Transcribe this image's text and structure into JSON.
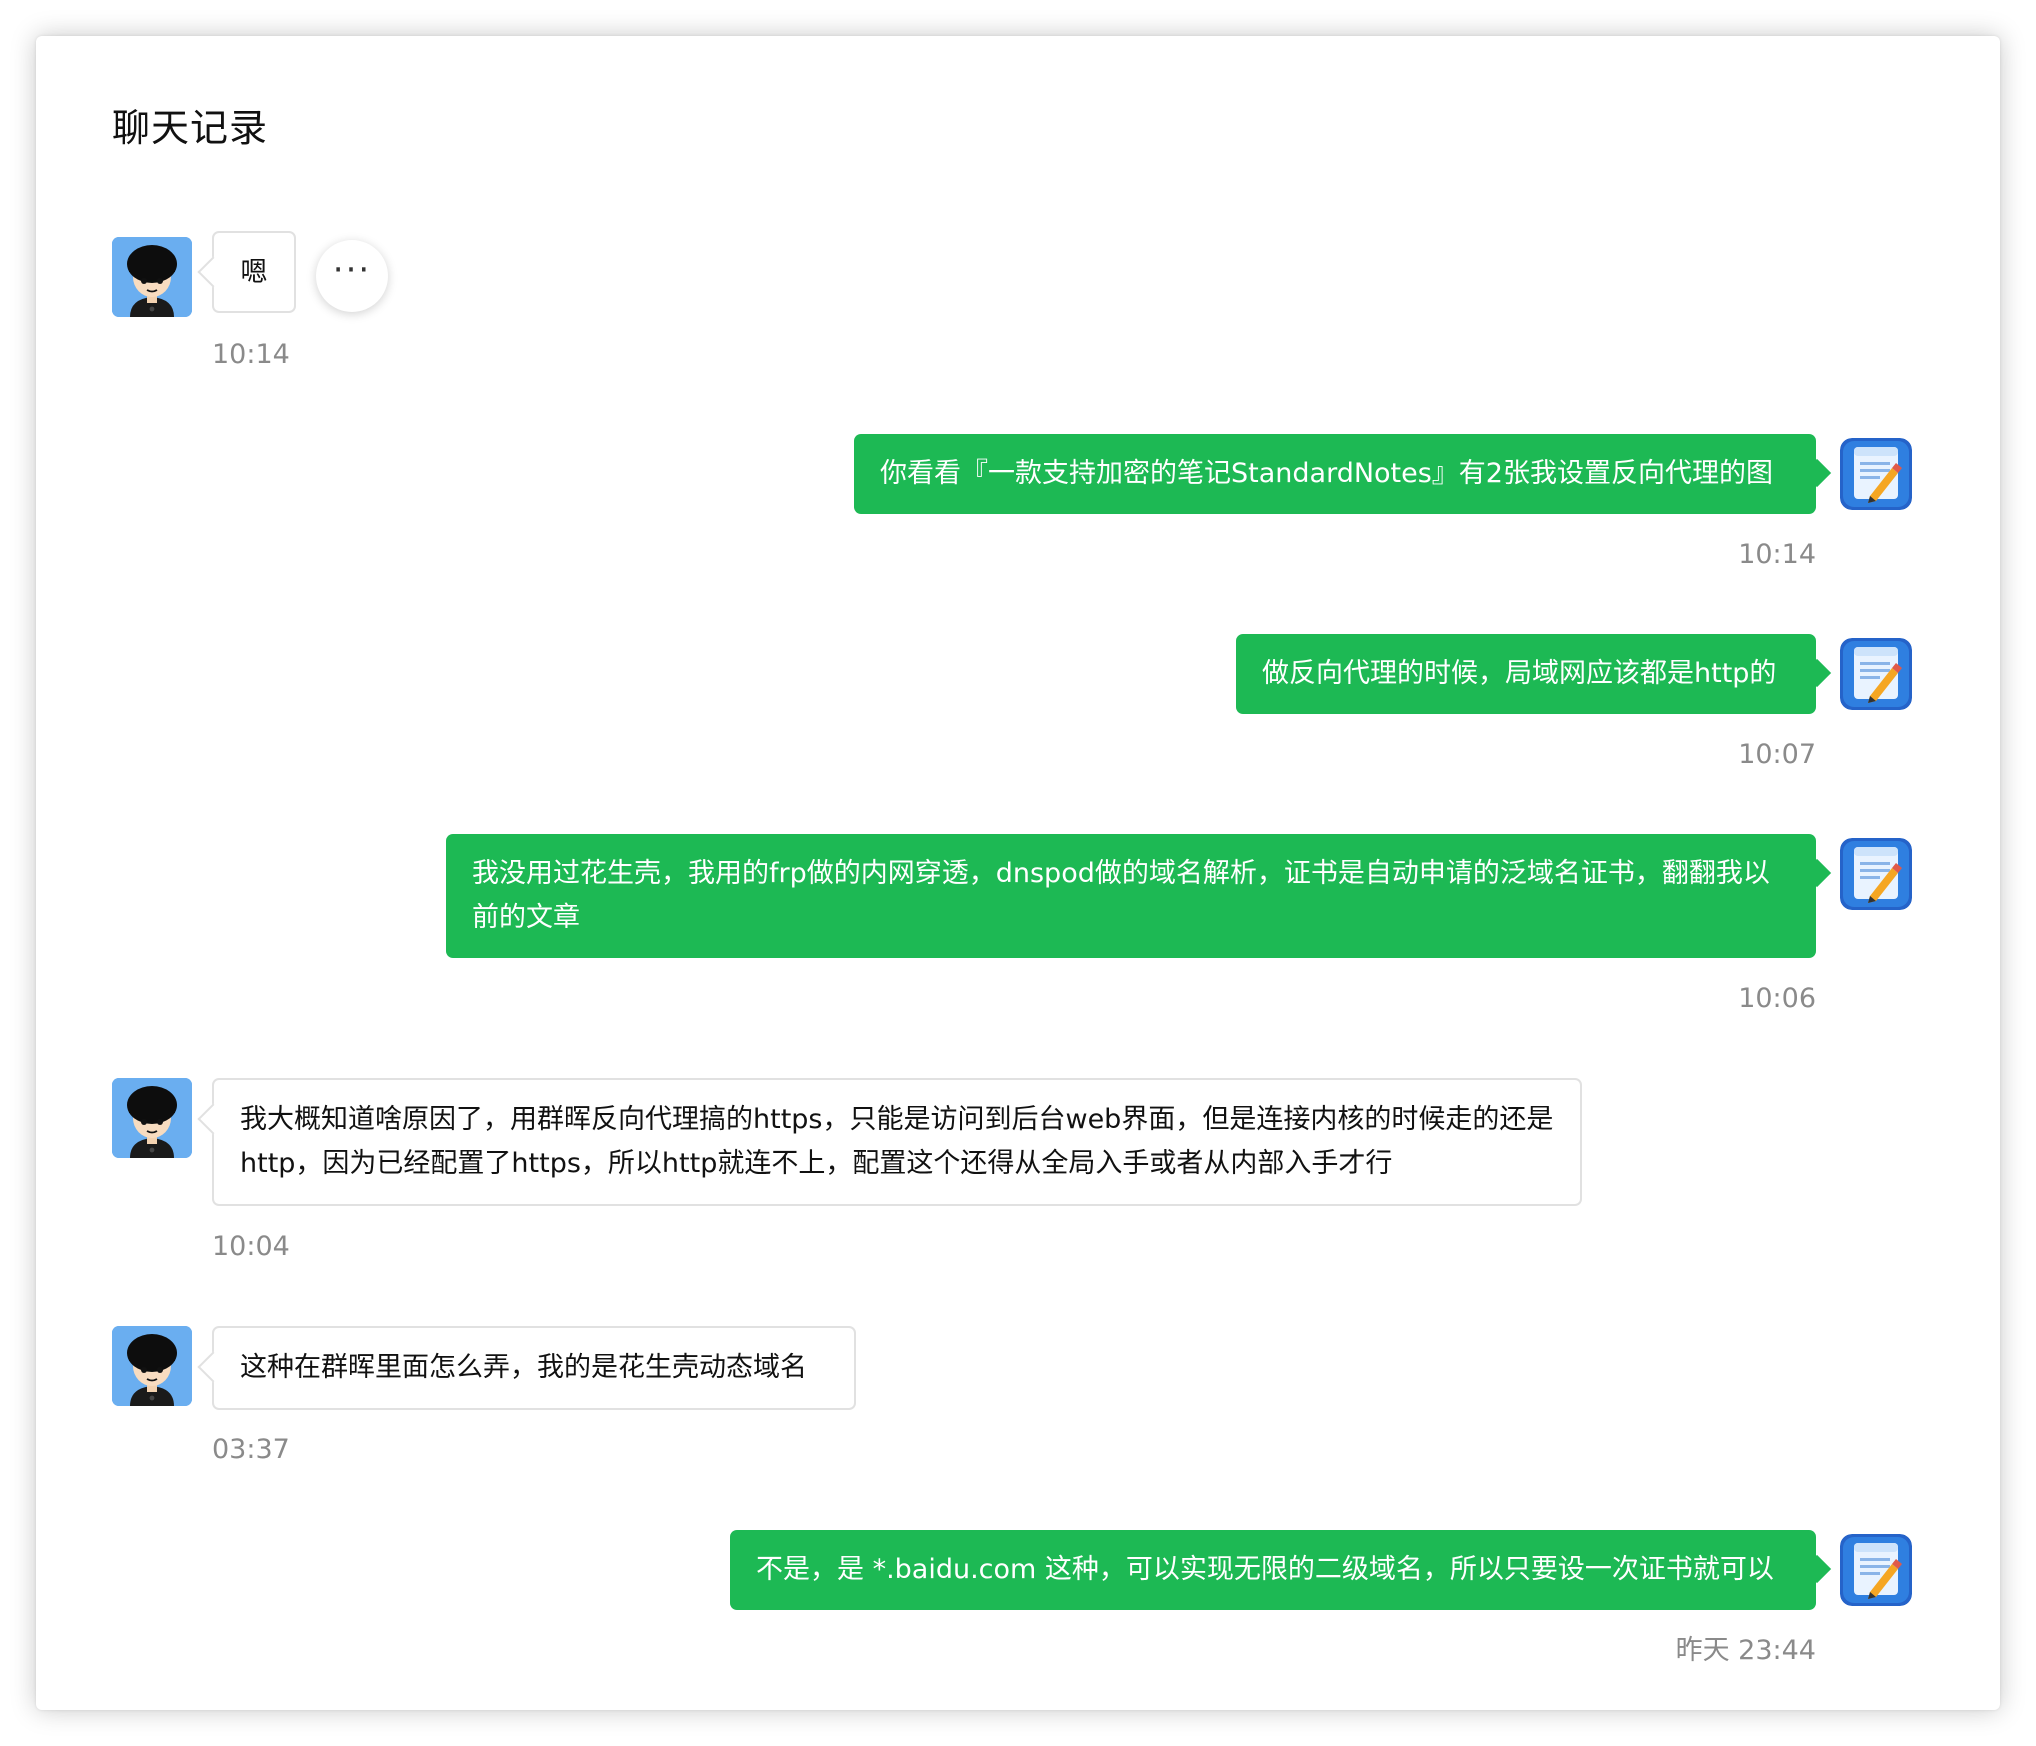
{
  "header": {
    "title": "聊天记录"
  },
  "more_button": {
    "label": "···"
  },
  "messages": [
    {
      "side": "left",
      "text": "嗯",
      "time": "10:14"
    },
    {
      "side": "right",
      "text": "你看看『一款支持加密的笔记StandardNotes』有2张我设置反向代理的图",
      "time": "10:14"
    },
    {
      "side": "right",
      "text": "做反向代理的时候，局域网应该都是http的",
      "time": "10:07"
    },
    {
      "side": "right",
      "text": "我没用过花生壳，我用的frp做的内网穿透，dnspod做的域名解析，证书是自动申请的泛域名证书，翻翻我以前的文章",
      "time": "10:06"
    },
    {
      "side": "left",
      "text": "我大概知道啥原因了，用群晖反向代理搞的https，只能是访问到后台web界面，但是连接内核的时候走的还是http，因为已经配置了https，所以http就连不上，配置这个还得从全局入手或者从内部入手才行",
      "time": "10:04"
    },
    {
      "side": "left",
      "text": "这种在群晖里面怎么弄，我的是花生壳动态域名",
      "time": "03:37"
    },
    {
      "side": "right",
      "text": "不是，是 *.baidu.com 这种，可以实现无限的二级域名，所以只要设一次证书就可以",
      "time": "昨天 23:44"
    }
  ],
  "colors": {
    "sent_bubble": "#1db954",
    "received_bubble": "#ffffff",
    "timestamp": "#8a8a8a",
    "avatar_bg_left": "#6aaef0",
    "avatar_bg_right": "#2563c9"
  },
  "icons": {
    "left_avatar": "cartoon-boy-avatar",
    "right_avatar": "notes-app-avatar",
    "more": "more-icon"
  }
}
